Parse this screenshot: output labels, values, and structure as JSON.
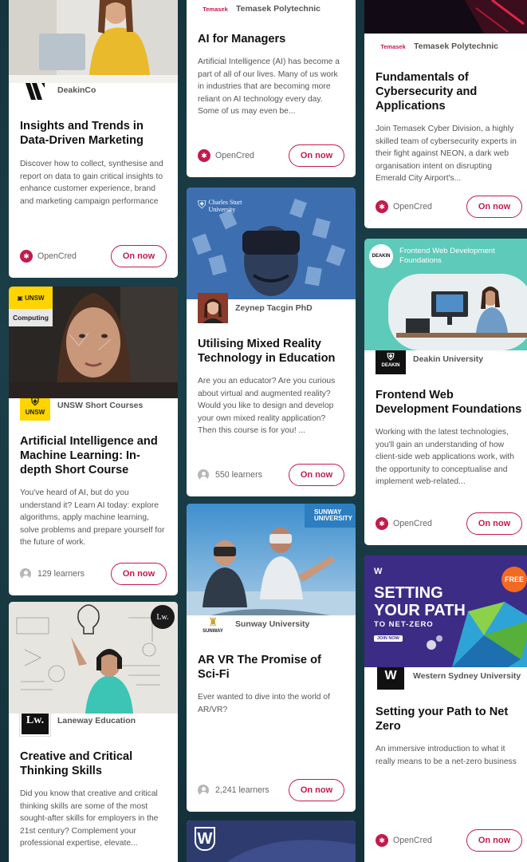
{
  "colors": {
    "accent": "#c21b4b",
    "background": "#183942"
  },
  "cards": {
    "deakinco": {
      "provider": "DeakinCo",
      "title": "Insights and Trends in Data-Driven Marketing",
      "description": "Discover how to collect, synthesise and report on data to gain critical insights to enhance customer experience, brand and marketing campaign performance",
      "meta": "OpenCred",
      "button": "On now"
    },
    "unsw": {
      "badge": "Computing",
      "logo_text": "UNSW",
      "provider": "UNSW Short Courses",
      "title": "Artificial Intelligence and Machine Learning: In-depth Short Course",
      "description": "You've heard of AI, but do you understand it? Learn AI today: explore algorithms, apply machine learning, solve problems and prepare yourself for the future of work.",
      "meta": "129 learners",
      "button": "On now"
    },
    "laneway": {
      "logo_text": "Lw.",
      "provider": "Laneway Education",
      "title": "Creative and Critical Thinking Skills",
      "description": "Did you know that creative and critical thinking skills are some of the most sought-after skills for employers in the 21st century? Complement your professional expertise, elevate..."
    },
    "ai_managers": {
      "logo_text": "Temasek",
      "provider": "Temasek Polytechnic",
      "title": "AI for Managers",
      "description": "Artificial Intelligence (AI) has become a part of all of our lives. Many of us work in industries that are becoming more reliant on AI technology every day. Some of us may even be...",
      "meta": "OpenCred",
      "button": "On now"
    },
    "mixed_reality": {
      "hero_logo": "Charles Sturt University",
      "provider": "Zeynep Tacgin PhD",
      "title": "Utilising Mixed Reality Technology in Education",
      "description": "Are you an educator? Are you curious about virtual and augmented reality? Would you like to design and develop your own mixed reality application? Then this course is for you! ...",
      "meta": "550 learners",
      "button": "On now"
    },
    "arvr": {
      "hero_logo": "SUNWAY UNIVERSITY",
      "logo_text": "SUNWAY",
      "provider": "Sunway University",
      "title": "AR VR The Promise of Sci-Fi",
      "description": "Ever wanted to dive into the world of AR/VR?",
      "meta": "2,241 learners",
      "button": "On now"
    },
    "cyber": {
      "logo_text": "Temasek",
      "provider": "Temasek Polytechnic",
      "title": "Fundamentals of Cybersecurity and Applications",
      "description": "Join Temasek Cyber Division, a highly skilled team of cybersecurity experts in their fight against NEON, a dark web organisation intent on disrupting Emerald City Airport's...",
      "meta": "OpenCred",
      "button": "On now"
    },
    "frontend": {
      "hero_logo": "DEAKIN",
      "hero_title": "Frontend Web Development Foundations",
      "logo_text": "DEAKIN",
      "provider": "Deakin University",
      "title": "Frontend Web Development Foundations",
      "description": "Working with the latest technologies, you'll gain an understanding of how client-side web applications work, with the opportunity to conceptualise and implement web-related...",
      "meta": "OpenCred",
      "button": "On now"
    },
    "netzero": {
      "hero_line1": "SETTING",
      "hero_line2": "YOUR PATH",
      "hero_line3": "TO NET-ZERO",
      "hero_join": "JOIN NOW",
      "hero_free": "FREE",
      "provider": "Western Sydney University",
      "title": "Setting your Path to Net Zero",
      "description": "An immersive introduction to what it really means to be a net-zero business",
      "meta": "OpenCred",
      "button": "On now"
    }
  }
}
